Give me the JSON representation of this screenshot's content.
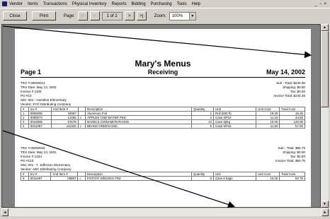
{
  "menu": {
    "items": [
      "Vendor",
      "Items",
      "Transactions",
      "Physical Inventory",
      "Reports",
      "Bidding",
      "Purchasing",
      "Tools",
      "Help"
    ],
    "window_controls": "_ ▫ ×"
  },
  "toolbar": {
    "close_label": "Close",
    "print_label": "Print",
    "page_label": "Page:",
    "first_label": "|<",
    "prev_label": "<",
    "page_value": "1 of 2",
    "next_label": ">",
    "last_label": ">|",
    "zoom_label": "Zoom:",
    "zoom_value": "100%"
  },
  "report": {
    "title": "Mary's Menus",
    "subtitle": "Receiving",
    "page": "Page 1",
    "date": "May 14, 2002",
    "columns": [
      "#",
      "Inv #",
      "Vnd Item #",
      "",
      "Description",
      "Quantity",
      "Unit",
      "Unit Cost",
      "Total Cost"
    ],
    "transactions": [
      {
        "header": [
          "TRX # 00000014",
          "TRX Date: May 13, 2002",
          "Invoice # 1105",
          "PO #10",
          "Site: 004 - Hamilton Elementary",
          "Vendor: XYZ Distributing Company"
        ],
        "summary": [
          "Sub - Total: $240.35",
          "Shipping: $0.00",
          "Tax: $0.00",
          "Invoice Total: $240.35"
        ],
        "rows": [
          [
            "1",
            "0900005",
            "34567",
            "",
            "Aluminum Foil",
            "1",
            "Roll (500 ft)",
            "18.25",
            "18.25"
          ],
          [
            "2",
            "0090074",
            "12456",
            "c",
            "APPLES CND WATER PKD",
            "4",
            "Case 6/#10",
            "11.15",
            "44.60"
          ],
          [
            "3",
            "0010005",
            "67678",
            "",
            "BAGELS CINNAMON-RAISIN",
            "12",
            "Case 6pkg",
            "10.00",
            "120.00"
          ],
          [
            "4",
            "0011057",
            "111332",
            "c",
            "BEANS GREEN CND",
            "5",
            "Case 6/#10",
            "11.50",
            "57.50"
          ]
        ]
      },
      {
        "header": [
          "TRX # 00000015",
          "TRX Date: May 13, 2002",
          "Invoice # 1234",
          "PO #123",
          "Site: 001 - T. Jefferson Elementary",
          "Vendor: ABC Distributing Company"
        ],
        "summary": [
          "Sub - Total: $50.75",
          "Shipping: $0.00",
          "Tax: $0.00",
          "Invoice Total: $50.75"
        ],
        "rows": [
          [
            "5",
            "0011697",
            "09887",
            "c",
            "POTATO WEDGES FRZ",
            "5",
            "Case 6 bags",
            "10.15",
            "50.75"
          ]
        ]
      }
    ]
  },
  "icons": {
    "app": "app-icon",
    "scroll_up": "▲",
    "scroll_down": "▼",
    "scroll_left": "◄",
    "scroll_right": "►"
  },
  "colors": {
    "chrome": "#d4d0c8",
    "viewer_bg": "#808080",
    "annotation_arrow": "#000000"
  }
}
